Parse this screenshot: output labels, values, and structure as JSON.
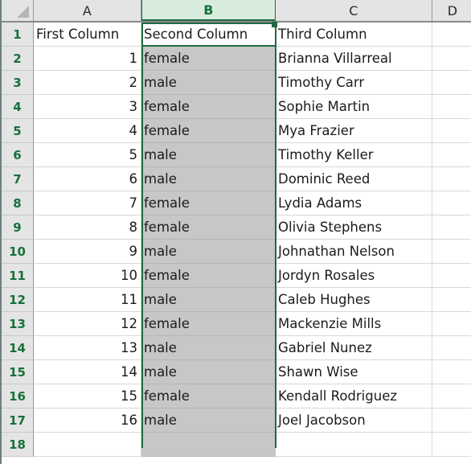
{
  "app": {
    "type": "spreadsheet",
    "accent_green": "#1e6b41",
    "header_selected_fill": "#d8ecdd",
    "selection_fill": "#c7c7c7"
  },
  "corner": {
    "name": "select-all-corner"
  },
  "columns": [
    {
      "letter": "A",
      "selected": false
    },
    {
      "letter": "B",
      "selected": true
    },
    {
      "letter": "C",
      "selected": false
    },
    {
      "letter": "D",
      "selected": false
    }
  ],
  "active_cell": "B1",
  "selected_column": "B",
  "rows": [
    {
      "num": "1",
      "a": "First Column",
      "b": "Second Column",
      "c": "Third Column",
      "d": ""
    },
    {
      "num": "2",
      "a": "1",
      "b": "female",
      "c": "Brianna Villarreal",
      "d": ""
    },
    {
      "num": "3",
      "a": "2",
      "b": "male",
      "c": "Timothy Carr",
      "d": ""
    },
    {
      "num": "4",
      "a": "3",
      "b": "female",
      "c": "Sophie Martin",
      "d": ""
    },
    {
      "num": "5",
      "a": "4",
      "b": "female",
      "c": "Mya Frazier",
      "d": ""
    },
    {
      "num": "6",
      "a": "5",
      "b": "male",
      "c": "Timothy Keller",
      "d": ""
    },
    {
      "num": "7",
      "a": "6",
      "b": "male",
      "c": "Dominic Reed",
      "d": ""
    },
    {
      "num": "8",
      "a": "7",
      "b": "female",
      "c": "Lydia Adams",
      "d": ""
    },
    {
      "num": "9",
      "a": "8",
      "b": "female",
      "c": "Olivia Stephens",
      "d": ""
    },
    {
      "num": "10",
      "a": "9",
      "b": "male",
      "c": "Johnathan Nelson",
      "d": ""
    },
    {
      "num": "11",
      "a": "10",
      "b": "female",
      "c": "Jordyn Rosales",
      "d": ""
    },
    {
      "num": "12",
      "a": "11",
      "b": "male",
      "c": "Caleb Hughes",
      "d": ""
    },
    {
      "num": "13",
      "a": "12",
      "b": "female",
      "c": "Mackenzie Mills",
      "d": ""
    },
    {
      "num": "14",
      "a": "13",
      "b": "male",
      "c": "Gabriel Nunez",
      "d": ""
    },
    {
      "num": "15",
      "a": "14",
      "b": "male",
      "c": "Shawn Wise",
      "d": ""
    },
    {
      "num": "16",
      "a": "15",
      "b": "female",
      "c": "Kendall Rodriguez",
      "d": ""
    },
    {
      "num": "17",
      "a": "16",
      "b": "male",
      "c": "Joel Jacobson",
      "d": ""
    },
    {
      "num": "18",
      "a": "",
      "b": "",
      "c": "",
      "d": ""
    }
  ]
}
